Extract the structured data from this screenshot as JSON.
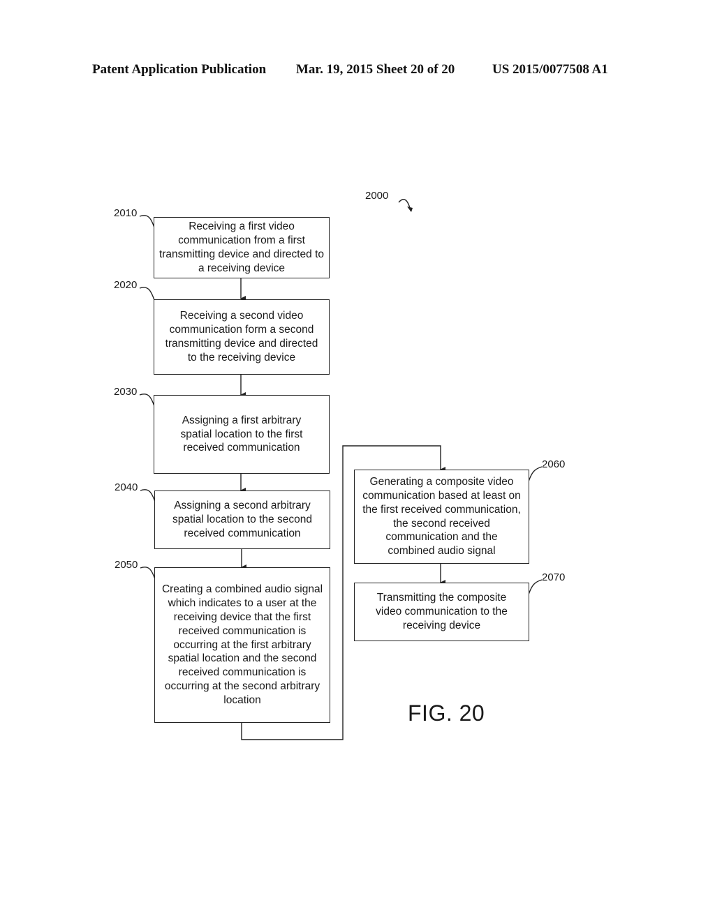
{
  "header": {
    "publication": "Patent Application Publication",
    "date_sheet": "Mar. 19, 2015  Sheet 20 of 20",
    "number": "US 2015/0077508 A1"
  },
  "figure": {
    "ref": "2000",
    "caption": "FIG. 20"
  },
  "steps": [
    {
      "ref": "2010",
      "text": "Receiving a first video communication from a first transmitting device and directed to a receiving device"
    },
    {
      "ref": "2020",
      "text": "Receiving a second video communication form a second transmitting device and directed to the receiving device"
    },
    {
      "ref": "2030",
      "text": "Assigning a first arbitrary spatial location to the first received communication"
    },
    {
      "ref": "2040",
      "text": "Assigning a second arbitrary spatial location to the second received communication"
    },
    {
      "ref": "2050",
      "text": "Creating a combined audio signal which indicates to a user at the receiving device that the first received communication is occurring at the first arbitrary spatial location and the second received communication is occurring at the second arbitrary location"
    },
    {
      "ref": "2060",
      "text": "Generating a composite video communication based at least on the first received communication, the second received communication and the combined audio signal"
    },
    {
      "ref": "2070",
      "text": "Transmitting the composite video communication to the receiving device"
    }
  ]
}
